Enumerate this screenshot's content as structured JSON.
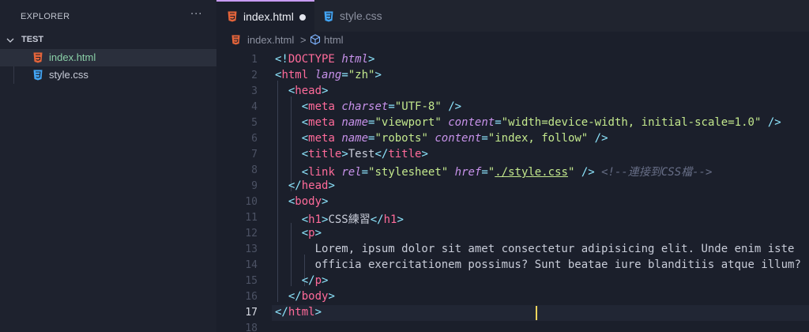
{
  "sidebar": {
    "title": "EXPLORER",
    "more_label": "···",
    "folder": "TEST",
    "files": [
      {
        "name": "index.html",
        "icon": "html5-icon",
        "active": true
      },
      {
        "name": "style.css",
        "icon": "css3-icon",
        "active": false
      }
    ]
  },
  "tabs": [
    {
      "label": "index.html",
      "icon": "html5-icon",
      "active": true,
      "modified": true
    },
    {
      "label": "style.css",
      "icon": "css3-icon",
      "active": false,
      "modified": false
    }
  ],
  "breadcrumb": {
    "file": "index.html",
    "separator": ">",
    "symbol": "html"
  },
  "editor": {
    "current_line": "17",
    "lines": [
      {
        "n": "1",
        "tokens": [
          [
            "p",
            "<!"
          ],
          [
            "t",
            "DOCTYPE"
          ],
          [
            "tx",
            " "
          ],
          [
            "a",
            "html"
          ],
          [
            "p",
            ">"
          ]
        ]
      },
      {
        "n": "2",
        "tokens": [
          [
            "p",
            "<"
          ],
          [
            "t",
            "html"
          ],
          [
            "tx",
            " "
          ],
          [
            "a",
            "lang"
          ],
          [
            "p",
            "="
          ],
          [
            "s",
            "\"zh\""
          ],
          [
            "p",
            ">"
          ]
        ]
      },
      {
        "n": "3",
        "tokens": [
          [
            "tx",
            "  "
          ],
          [
            "p",
            "<"
          ],
          [
            "t",
            "head"
          ],
          [
            "p",
            ">"
          ]
        ]
      },
      {
        "n": "4",
        "tokens": [
          [
            "tx",
            "    "
          ],
          [
            "p",
            "<"
          ],
          [
            "t",
            "meta"
          ],
          [
            "tx",
            " "
          ],
          [
            "a",
            "charset"
          ],
          [
            "p",
            "="
          ],
          [
            "s",
            "\"UTF-8\""
          ],
          [
            "tx",
            " "
          ],
          [
            "p",
            "/>"
          ]
        ]
      },
      {
        "n": "5",
        "tokens": [
          [
            "tx",
            "    "
          ],
          [
            "p",
            "<"
          ],
          [
            "t",
            "meta"
          ],
          [
            "tx",
            " "
          ],
          [
            "a",
            "name"
          ],
          [
            "p",
            "="
          ],
          [
            "s",
            "\"viewport\""
          ],
          [
            "tx",
            " "
          ],
          [
            "a",
            "content"
          ],
          [
            "p",
            "="
          ],
          [
            "s",
            "\"width=device-width, initial-scale=1.0\""
          ],
          [
            "tx",
            " "
          ],
          [
            "p",
            "/>"
          ]
        ]
      },
      {
        "n": "6",
        "tokens": [
          [
            "tx",
            "    "
          ],
          [
            "p",
            "<"
          ],
          [
            "t",
            "meta"
          ],
          [
            "tx",
            " "
          ],
          [
            "a",
            "name"
          ],
          [
            "p",
            "="
          ],
          [
            "s",
            "\"robots\""
          ],
          [
            "tx",
            " "
          ],
          [
            "a",
            "content"
          ],
          [
            "p",
            "="
          ],
          [
            "s",
            "\"index, follow\""
          ],
          [
            "tx",
            " "
          ],
          [
            "p",
            "/>"
          ]
        ]
      },
      {
        "n": "7",
        "tokens": [
          [
            "tx",
            "    "
          ],
          [
            "p",
            "<"
          ],
          [
            "t",
            "title"
          ],
          [
            "p",
            ">"
          ],
          [
            "tx",
            "Test"
          ],
          [
            "p",
            "</"
          ],
          [
            "t",
            "title"
          ],
          [
            "p",
            ">"
          ]
        ]
      },
      {
        "n": "8",
        "tokens": [
          [
            "tx",
            "    "
          ],
          [
            "p",
            "<"
          ],
          [
            "t",
            "link"
          ],
          [
            "tx",
            " "
          ],
          [
            "a",
            "rel"
          ],
          [
            "p",
            "="
          ],
          [
            "s",
            "\"stylesheet\""
          ],
          [
            "tx",
            " "
          ],
          [
            "a",
            "href"
          ],
          [
            "p",
            "="
          ],
          [
            "s",
            "\""
          ],
          [
            "s u",
            "./style.css"
          ],
          [
            "s",
            "\""
          ],
          [
            "tx",
            " "
          ],
          [
            "p",
            "/>"
          ],
          [
            "tx",
            " "
          ],
          [
            "c",
            "<!--連接到CSS檔-->"
          ]
        ]
      },
      {
        "n": "9",
        "tokens": [
          [
            "tx",
            "  "
          ],
          [
            "p",
            "</"
          ],
          [
            "t",
            "head"
          ],
          [
            "p",
            ">"
          ]
        ]
      },
      {
        "n": "10",
        "tokens": [
          [
            "tx",
            "  "
          ],
          [
            "p",
            "<"
          ],
          [
            "t",
            "body"
          ],
          [
            "p",
            ">"
          ]
        ]
      },
      {
        "n": "11",
        "tokens": [
          [
            "tx",
            "    "
          ],
          [
            "p",
            "<"
          ],
          [
            "t",
            "h1"
          ],
          [
            "p",
            ">"
          ],
          [
            "tx",
            "CSS練習"
          ],
          [
            "p",
            "</"
          ],
          [
            "t",
            "h1"
          ],
          [
            "p",
            ">"
          ]
        ]
      },
      {
        "n": "12",
        "tokens": [
          [
            "tx",
            "    "
          ],
          [
            "p",
            "<"
          ],
          [
            "t",
            "p"
          ],
          [
            "p",
            ">"
          ]
        ]
      },
      {
        "n": "13",
        "tokens": [
          [
            "tx",
            "      Lorem, ipsum dolor sit amet consectetur adipisicing elit. Unde enim iste"
          ]
        ]
      },
      {
        "n": "14",
        "tokens": [
          [
            "tx",
            "      officia exercitationem possimus? Sunt beatae iure blanditiis atque illum?"
          ]
        ]
      },
      {
        "n": "15",
        "tokens": [
          [
            "tx",
            "    "
          ],
          [
            "p",
            "</"
          ],
          [
            "t",
            "p"
          ],
          [
            "p",
            ">"
          ]
        ]
      },
      {
        "n": "16",
        "tokens": [
          [
            "tx",
            "  "
          ],
          [
            "p",
            "</"
          ],
          [
            "t",
            "body"
          ],
          [
            "p",
            ">"
          ]
        ]
      },
      {
        "n": "17",
        "tokens": [
          [
            "p",
            "</"
          ],
          [
            "t",
            "html"
          ],
          [
            "p",
            ">"
          ]
        ]
      },
      {
        "n": "18",
        "tokens": []
      }
    ]
  },
  "colors": {
    "accent": "#c79bf2",
    "html_icon": "#e4643a",
    "css_icon": "#42a5f5",
    "cursor": "#f6d55c"
  }
}
